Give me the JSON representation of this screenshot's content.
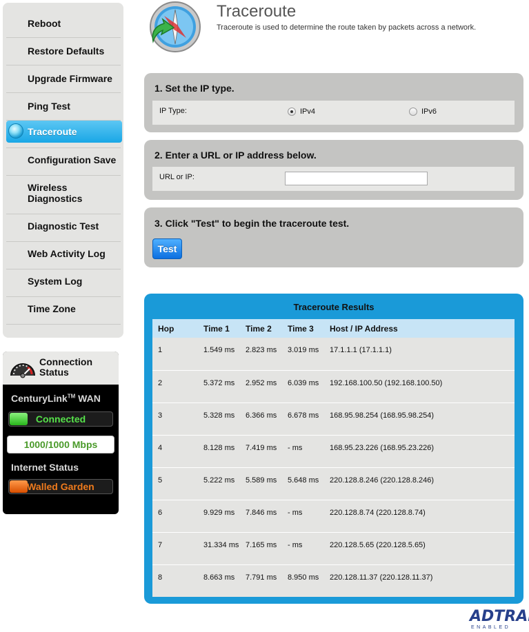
{
  "sidebar": {
    "items": [
      {
        "label": "Reboot",
        "active": false
      },
      {
        "label": "Restore Defaults",
        "active": false
      },
      {
        "label": "Upgrade Firmware",
        "active": false
      },
      {
        "label": "Ping Test",
        "active": false
      },
      {
        "label": "Traceroute",
        "active": true
      },
      {
        "label": "Configuration Save",
        "active": false
      },
      {
        "label": "Wireless Diagnostics",
        "active": false
      },
      {
        "label": "Diagnostic Test",
        "active": false
      },
      {
        "label": "Web Activity Log",
        "active": false
      },
      {
        "label": "System Log",
        "active": false
      },
      {
        "label": "Time Zone",
        "active": false
      }
    ]
  },
  "status": {
    "title": "Connection Status",
    "wan_brand": "CenturyLink",
    "wan_tm": "TM",
    "wan_suffix": "WAN",
    "wan_state": "Connected",
    "speed": "1000/1000 Mbps",
    "internet_label": "Internet Status",
    "internet_state": "Walled Garden"
  },
  "header": {
    "title": "Traceroute",
    "description": "Traceroute is used to determine the route taken by packets across a network."
  },
  "step1": {
    "title": "1. Set the IP type.",
    "label": "IP Type:",
    "option_v4": "IPv4",
    "option_v6": "IPv6",
    "selected": "IPv4"
  },
  "step2": {
    "title": "2. Enter a URL or IP address below.",
    "label": "URL or IP:",
    "value": ""
  },
  "step3": {
    "title": "3. Click \"Test\" to begin the traceroute test.",
    "button": "Test"
  },
  "results": {
    "title": "Traceroute Results",
    "columns": [
      "Hop",
      "Time 1",
      "Time 2",
      "Time 3",
      "Host / IP Address"
    ],
    "rows": [
      [
        "1",
        "1.549 ms",
        "2.823 ms",
        "3.019 ms",
        "17.1.1.1 (17.1.1.1)"
      ],
      [
        "2",
        "5.372 ms",
        "2.952 ms",
        "6.039 ms",
        "192.168.100.50 (192.168.100.50)"
      ],
      [
        "3",
        "5.328 ms",
        "6.366 ms",
        "6.678 ms",
        "168.95.98.254 (168.95.98.254)"
      ],
      [
        "4",
        "8.128 ms",
        "7.419 ms",
        "- ms",
        "168.95.23.226 (168.95.23.226)"
      ],
      [
        "5",
        "5.222 ms",
        "5.589 ms",
        "5.648 ms",
        "220.128.8.246 (220.128.8.246)"
      ],
      [
        "6",
        "9.929 ms",
        "7.846 ms",
        "- ms",
        "220.128.8.74 (220.128.8.74)"
      ],
      [
        "7",
        "31.334 ms",
        "7.165 ms",
        "- ms",
        "220.128.5.65 (220.128.5.65)"
      ],
      [
        "8",
        "8.663 ms",
        "7.791 ms",
        "8.950 ms",
        "220.128.11.37 (220.128.11.37)"
      ]
    ]
  },
  "brand": {
    "name": "ADTRAN",
    "tagline": "ENABLED"
  }
}
